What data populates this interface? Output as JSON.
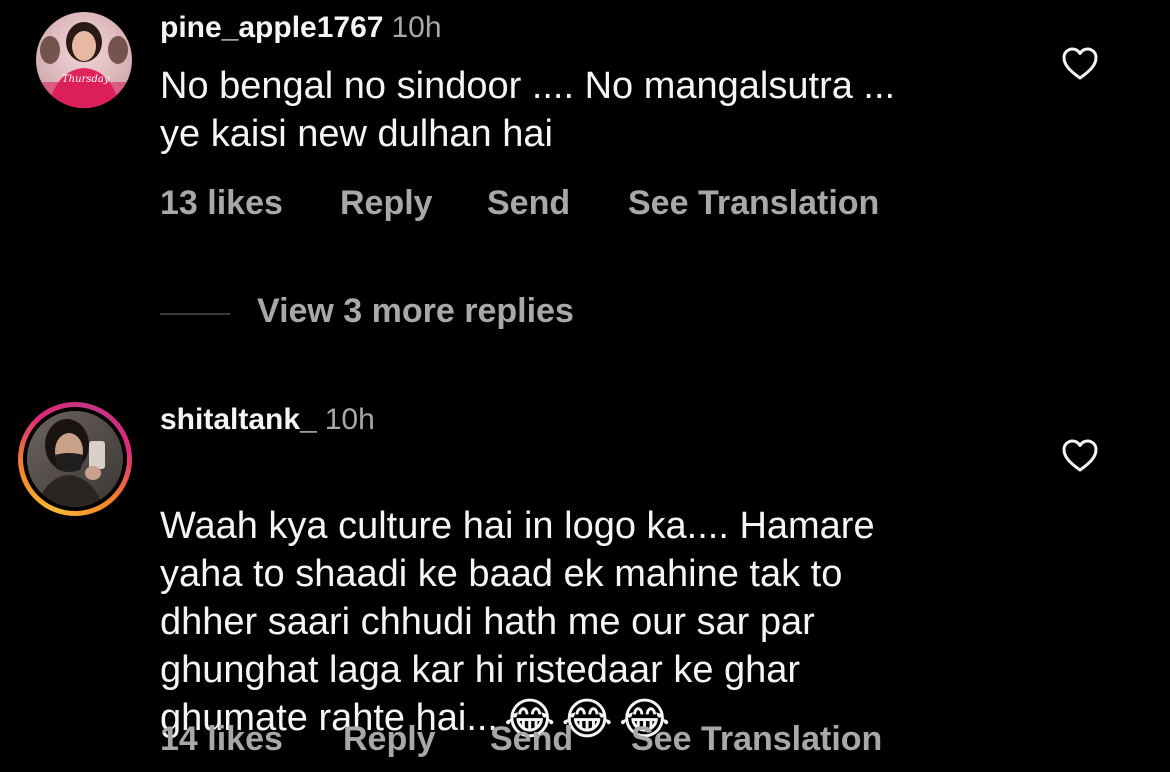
{
  "comments": [
    {
      "username": "pine_apple1767",
      "time": "10h",
      "text": "No bengal no sindoor .... No mangalsutra ...\nye kaisi new dulhan hai",
      "likes": "13 likes",
      "reply": "Reply",
      "send": "Send",
      "translate": "See Translation",
      "avatar_text": "Thursday"
    },
    {
      "username": "shitaltank_",
      "time": "10h",
      "text": "Waah kya culture hai in logo ka.... Hamare\nyaha to shaadi ke baad ek mahine tak to\ndhher saari chhudi hath me our sar par\nghunghat laga kar hi ristedaar ke ghar\nghumate rahte hai...",
      "emojis": [
        "😂",
        "😂",
        "😂"
      ],
      "likes": "14 likes",
      "reply": "Reply",
      "send": "Send",
      "translate": "See Translation"
    }
  ],
  "view_replies": "View 3 more replies",
  "icons": {
    "like": "heart-icon"
  },
  "colors": {
    "background": "#000000",
    "primary_text": "#f5f5f5",
    "secondary_text": "#a8a8a8",
    "story_ring_start": "#f58529",
    "story_ring_end": "#dd2a7b"
  }
}
